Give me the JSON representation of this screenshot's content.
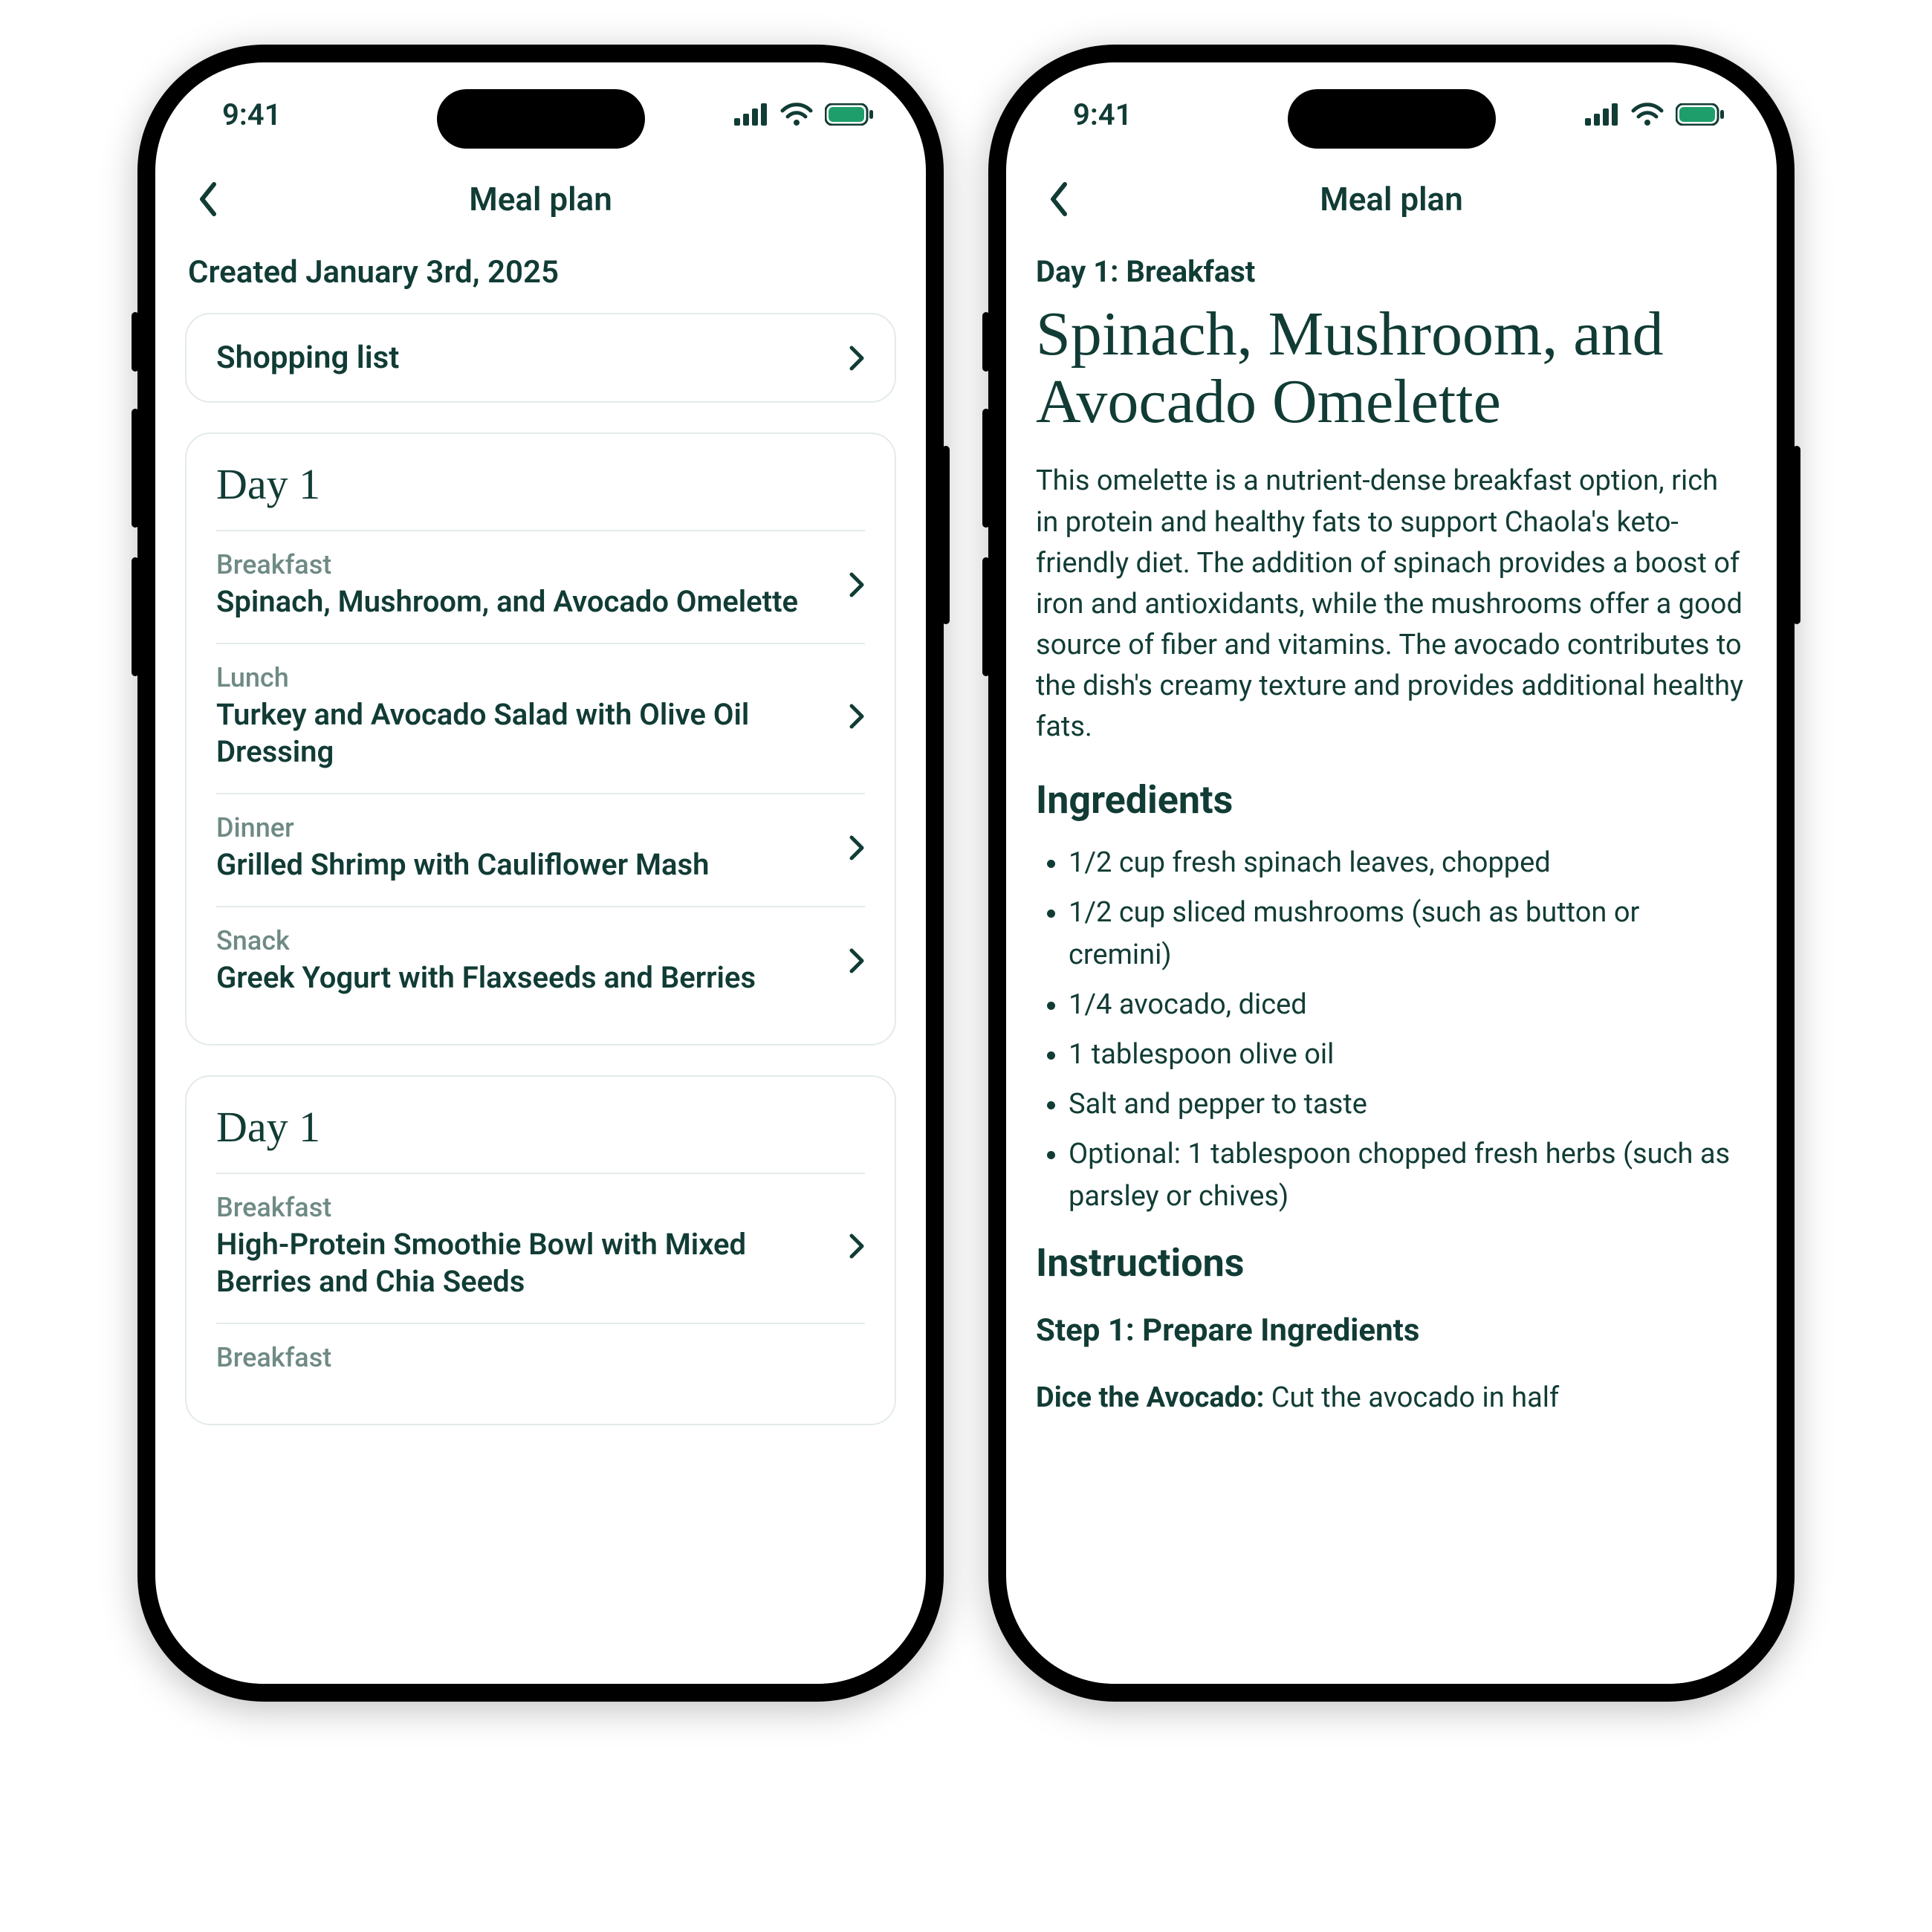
{
  "status": {
    "time": "9:41"
  },
  "nav": {
    "title": "Meal plan"
  },
  "left": {
    "created": "Created January 3rd, 2025",
    "shopping": "Shopping list",
    "days": [
      {
        "title": "Day 1",
        "meals": [
          {
            "kind": "Breakfast",
            "name": "Spinach, Mushroom, and Avocado Omelette"
          },
          {
            "kind": "Lunch",
            "name": "Turkey and Avocado Salad with Olive Oil Dressing"
          },
          {
            "kind": "Dinner",
            "name": "Grilled Shrimp with Cauliflower Mash"
          },
          {
            "kind": "Snack",
            "name": "Greek Yogurt with Flaxseeds and Berries"
          }
        ]
      },
      {
        "title": "Day 1",
        "meals": [
          {
            "kind": "Breakfast",
            "name": "High-Protein Smoothie Bowl with Mixed Berries and Chia Seeds"
          },
          {
            "kind": "Breakfast",
            "name": ""
          }
        ]
      }
    ]
  },
  "right": {
    "crumb": "Day 1: Breakfast",
    "title": "Spinach, Mushroom, and Avocado Omelette",
    "desc": "This omelette is a nutrient-dense breakfast option, rich in protein and healthy fats to support Chaola's keto-friendly diet. The addition of spinach provides a boost of iron and antioxidants, while the mushrooms offer a good source of fiber and vitamins. The avocado contributes to the dish's creamy texture and provides additional healthy fats.",
    "ingredients_h": "Ingredients",
    "ingredients": [
      "1/2 cup fresh spinach leaves, chopped",
      "1/2 cup sliced mushrooms (such as button or cremini)",
      "1/4 avocado, diced",
      "1 tablespoon olive oil",
      "Salt and pepper to taste",
      "Optional: 1 tablespoon chopped fresh herbs (such as parsley or chives)"
    ],
    "instructions_h": "Instructions",
    "step1_h": "Step 1: Prepare Ingredients",
    "step1_lead": "Dice the Avocado:",
    "step1_rest": " Cut the avocado in half"
  }
}
